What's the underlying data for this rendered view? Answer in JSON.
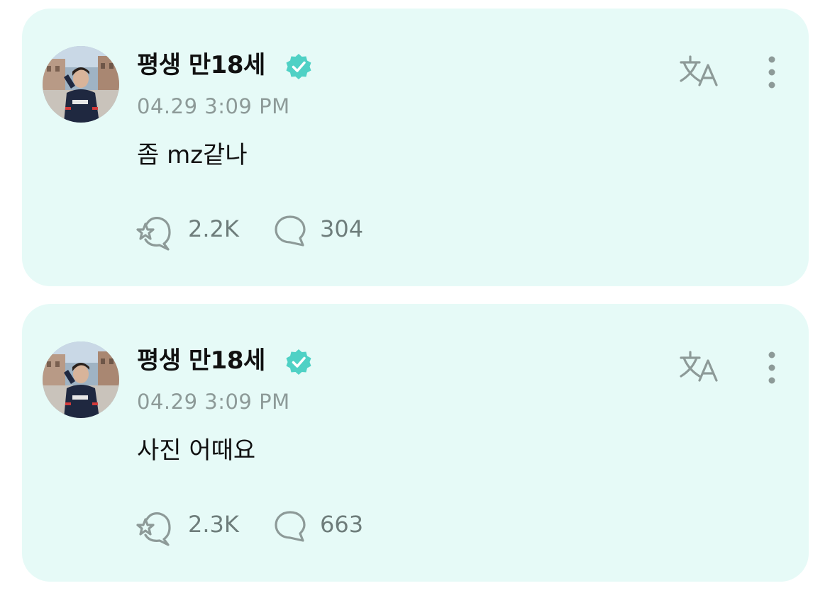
{
  "colors": {
    "card_background": "#e6faf7",
    "verified_badge": "#4fd1c5",
    "icon_gray": "#8d9a98"
  },
  "posts": [
    {
      "author": "평생 만18세",
      "timestamp": "04.29 3:09 PM",
      "text": "좀 mz같나",
      "reactions": "2.2K",
      "comments": "304",
      "icons": [
        "avatar",
        "verified-icon",
        "translate-icon",
        "more-icon",
        "reaction-icon",
        "comment-icon"
      ]
    },
    {
      "author": "평생 만18세",
      "timestamp": "04.29 3:09 PM",
      "text": "사진 어때요",
      "reactions": "2.3K",
      "comments": "663",
      "icons": [
        "avatar",
        "verified-icon",
        "translate-icon",
        "more-icon",
        "reaction-icon",
        "comment-icon"
      ]
    }
  ]
}
